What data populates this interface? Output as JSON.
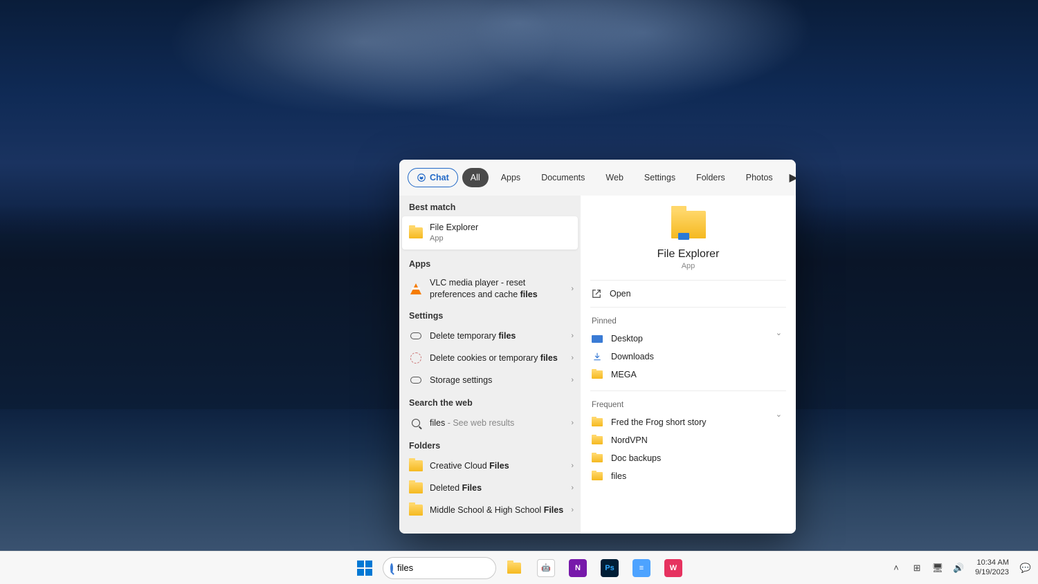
{
  "search_query": "files",
  "filters": {
    "chat": "Chat",
    "all": "All",
    "tabs": [
      "Apps",
      "Documents",
      "Web",
      "Settings",
      "Folders",
      "Photos"
    ]
  },
  "left": {
    "best_header": "Best match",
    "best": {
      "title": "File Explorer",
      "sub": "App"
    },
    "apps_header": "Apps",
    "apps": [
      {
        "pre": "VLC media player - reset preferences and cache ",
        "bold": "files"
      }
    ],
    "settings_header": "Settings",
    "settings": [
      {
        "pre": "Delete temporary ",
        "bold": "files"
      },
      {
        "pre": "Delete cookies or temporary ",
        "bold": "files"
      },
      {
        "pre": "Storage settings",
        "bold": ""
      }
    ],
    "web_header": "Search the web",
    "web": {
      "term": "files",
      "suffix": " - See web results"
    },
    "folders_header": "Folders",
    "folders": [
      {
        "pre": "Creative Cloud ",
        "bold": "Files"
      },
      {
        "pre": "Deleted ",
        "bold": "Files"
      },
      {
        "pre": "Middle School & High School ",
        "bold": "Files"
      }
    ]
  },
  "right": {
    "title": "File Explorer",
    "sub": "App",
    "open": "Open",
    "pinned_header": "Pinned",
    "pinned": [
      "Desktop",
      "Downloads",
      "MEGA"
    ],
    "frequent_header": "Frequent",
    "frequent": [
      "Fred the Frog short story",
      "NordVPN",
      "Doc backups",
      "files"
    ]
  },
  "taskbar": {
    "search_value": "files",
    "apps": [
      {
        "name": "file-explorer",
        "bg": "#f5b920",
        "label": ""
      },
      {
        "name": "copilot",
        "bg": "#ffffff",
        "label": "🌐"
      },
      {
        "name": "onenote",
        "bg": "#7719aa",
        "label": "N"
      },
      {
        "name": "photoshop",
        "bg": "#001e36",
        "label": "Ps"
      },
      {
        "name": "notepad",
        "bg": "#3a7bd5",
        "label": "≡"
      },
      {
        "name": "wondershare",
        "bg": "#e6325f",
        "label": "W"
      }
    ],
    "time": "10:34 AM",
    "date": "9/19/2023"
  }
}
